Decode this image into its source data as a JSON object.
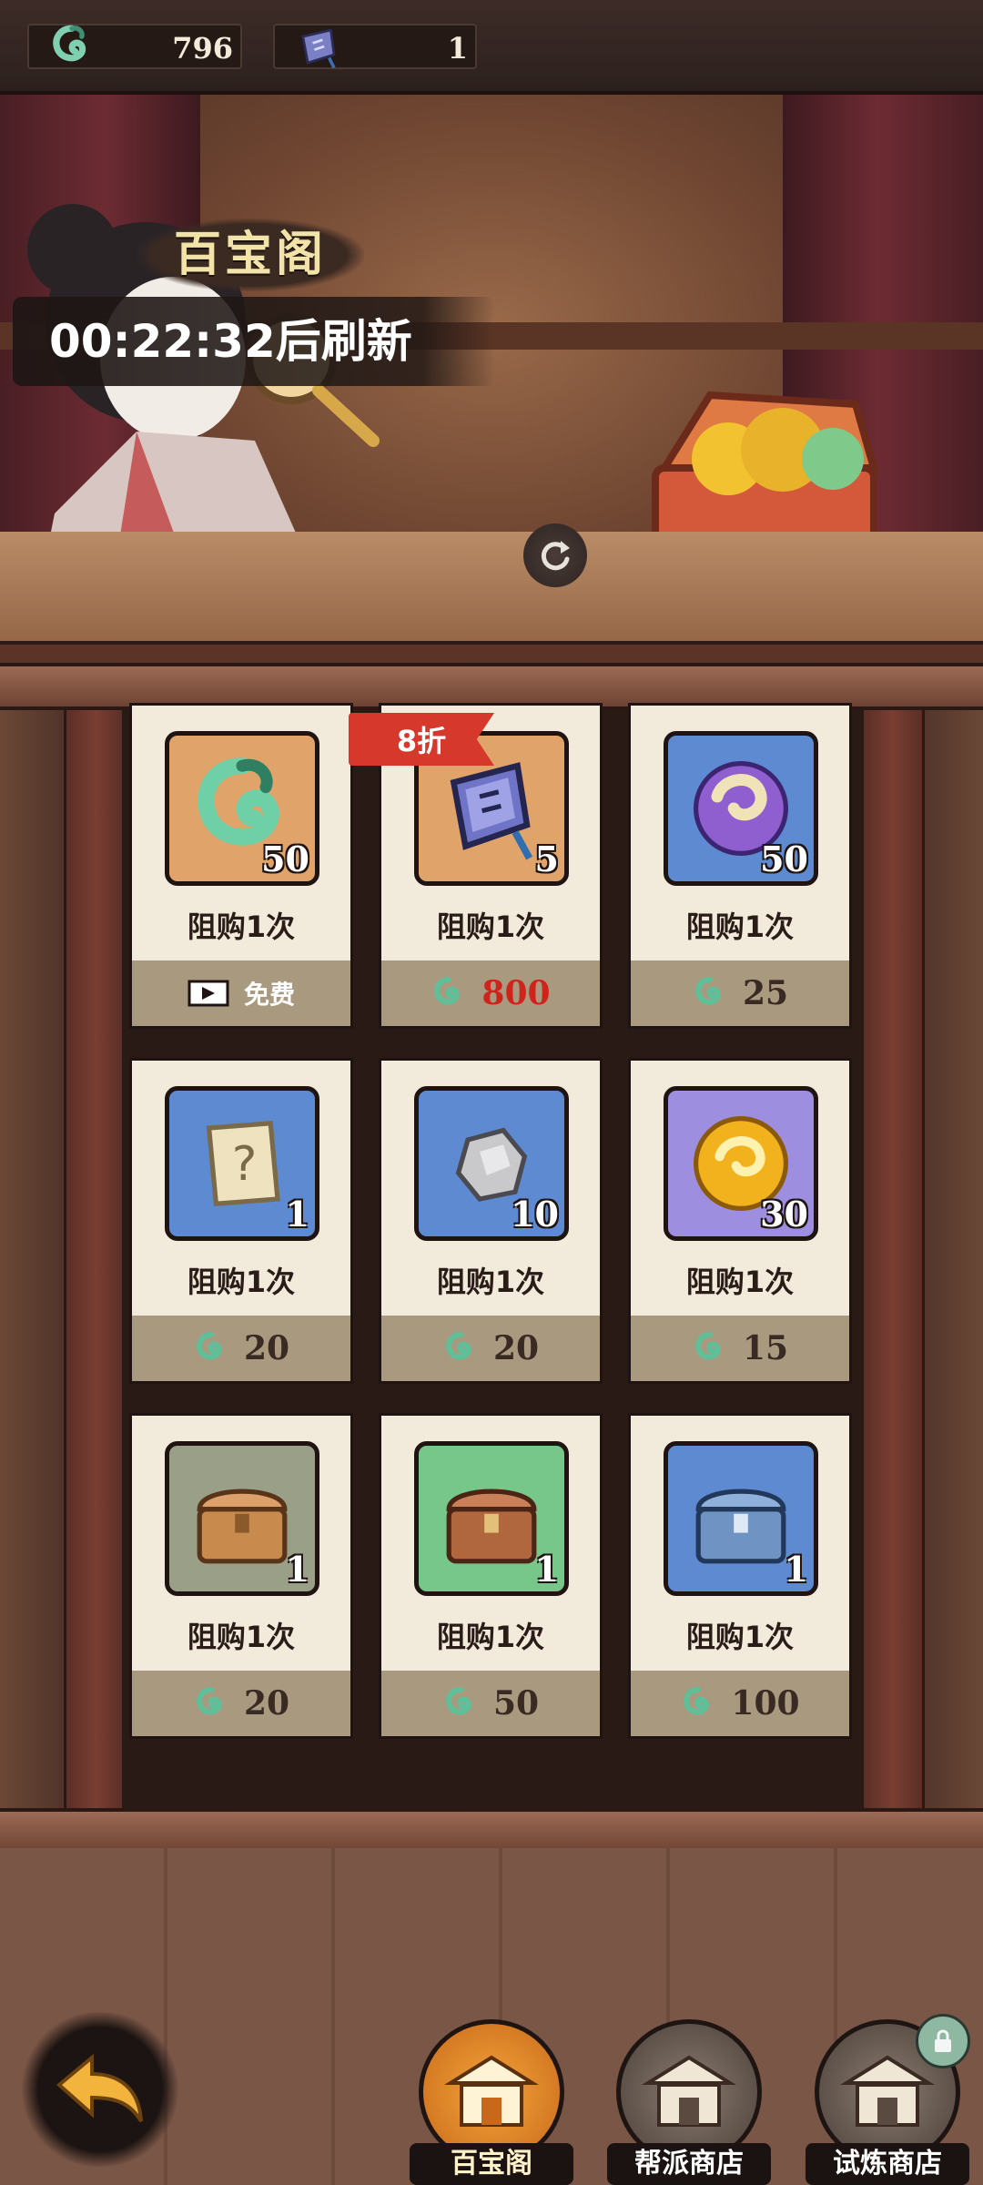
{
  "currencies": [
    {
      "icon": "jade-coin-icon",
      "value": "796"
    },
    {
      "icon": "token-plaque-icon",
      "value": "1"
    }
  ],
  "shop": {
    "title": "百宝阁",
    "refresh_timer": "00:22:32后刷新"
  },
  "items": [
    {
      "name": "jade-coin",
      "tile": "orange",
      "qty": "50",
      "limit": "阻购1次",
      "price_type": "ad",
      "price": "免费",
      "discount": ""
    },
    {
      "name": "token-plaque",
      "tile": "orange",
      "qty": "5",
      "limit": "阻购1次",
      "price_type": "coin",
      "price": "800",
      "price_color": "#d0231c",
      "discount": "8折"
    },
    {
      "name": "purple-orb",
      "tile": "blue",
      "qty": "50",
      "limit": "阻购1次",
      "price_type": "coin",
      "price": "25",
      "discount": ""
    },
    {
      "name": "mystery-scroll",
      "tile": "blue",
      "qty": "1",
      "limit": "阻购1次",
      "price_type": "coin",
      "price": "20",
      "discount": ""
    },
    {
      "name": "ore-stone",
      "tile": "blue",
      "qty": "10",
      "limit": "阻购1次",
      "price_type": "coin",
      "price": "20",
      "discount": ""
    },
    {
      "name": "gold-orb",
      "tile": "purple",
      "qty": "30",
      "limit": "阻购1次",
      "price_type": "coin",
      "price": "15",
      "discount": ""
    },
    {
      "name": "wooden-chest",
      "tile": "grey",
      "qty": "1",
      "limit": "阻购1次",
      "price_type": "coin",
      "price": "20",
      "discount": ""
    },
    {
      "name": "bronze-chest",
      "tile": "green",
      "qty": "1",
      "limit": "阻购1次",
      "price_type": "coin",
      "price": "50",
      "discount": ""
    },
    {
      "name": "silver-chest",
      "tile": "blue",
      "qty": "1",
      "limit": "阻购1次",
      "price_type": "coin",
      "price": "100",
      "discount": ""
    }
  ],
  "nav": [
    {
      "label": "百宝阁",
      "active": true
    },
    {
      "label": "帮派商店",
      "active": false
    },
    {
      "label": "试炼商店",
      "active": false,
      "locked": true
    }
  ],
  "colors": {
    "accent": "#d6392c",
    "price_red": "#d0231c",
    "card_bg": "#f2eadb",
    "price_bar": "#a99a7f"
  }
}
